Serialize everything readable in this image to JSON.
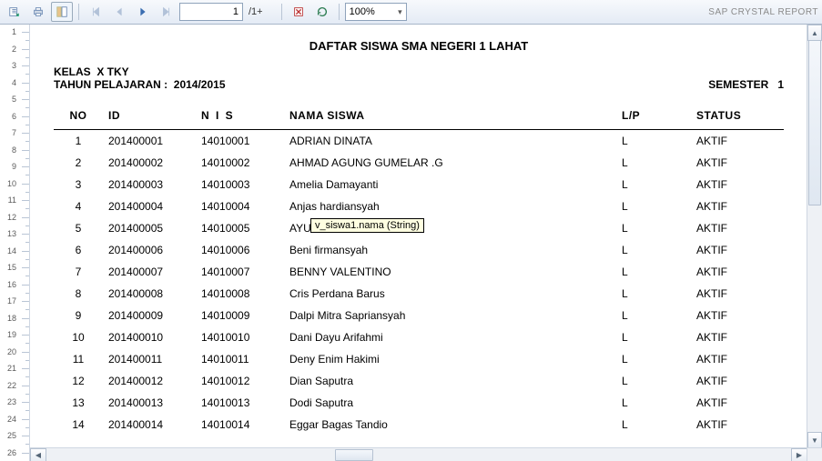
{
  "toolbar": {
    "page_current": "1",
    "page_total": "/1+",
    "zoom": "100%",
    "brand": "SAP CRYSTAL REPORT"
  },
  "report": {
    "title": "DAFTAR SISWA SMA  NEGERI 1 LAHAT",
    "kelas_label": "KELAS",
    "kelas_value": "X TKY",
    "tahun_label": "TAHUN PELAJARAN :",
    "tahun_value": "2014/2015",
    "semester_label": "SEMESTER",
    "semester_value": "1",
    "tooltip": "v_siswa1.nama (String)",
    "columns": {
      "no": "NO",
      "id": "ID",
      "nis": "N I S",
      "nama": "NAMA SISWA",
      "lp": "L/P",
      "status": "STATUS"
    },
    "rows": [
      {
        "no": "1",
        "id": "201400001",
        "nis": "14010001",
        "nama": "ADRIAN DINATA",
        "lp": "L",
        "status": "AKTIF"
      },
      {
        "no": "2",
        "id": "201400002",
        "nis": "14010002",
        "nama": "AHMAD AGUNG GUMELAR .G",
        "lp": "L",
        "status": "AKTIF"
      },
      {
        "no": "3",
        "id": "201400003",
        "nis": "14010003",
        "nama": "Amelia Damayanti",
        "lp": "L",
        "status": "AKTIF"
      },
      {
        "no": "4",
        "id": "201400004",
        "nis": "14010004",
        "nama": "Anjas hardiansyah",
        "lp": "L",
        "status": "AKTIF"
      },
      {
        "no": "5",
        "id": "201400005",
        "nis": "14010005",
        "nama": "AYU WANDIRA",
        "lp": "L",
        "status": "AKTIF"
      },
      {
        "no": "6",
        "id": "201400006",
        "nis": "14010006",
        "nama": "Beni firmansyah",
        "lp": "L",
        "status": "AKTIF"
      },
      {
        "no": "7",
        "id": "201400007",
        "nis": "14010007",
        "nama": "BENNY VALENTINO",
        "lp": "L",
        "status": "AKTIF"
      },
      {
        "no": "8",
        "id": "201400008",
        "nis": "14010008",
        "nama": "Cris Perdana Barus",
        "lp": "L",
        "status": "AKTIF"
      },
      {
        "no": "9",
        "id": "201400009",
        "nis": "14010009",
        "nama": "Dalpi Mitra Sapriansyah",
        "lp": "L",
        "status": "AKTIF"
      },
      {
        "no": "10",
        "id": "201400010",
        "nis": "14010010",
        "nama": "Dani Dayu Arifahmi",
        "lp": "L",
        "status": "AKTIF"
      },
      {
        "no": "11",
        "id": "201400011",
        "nis": "14010011",
        "nama": "Deny Enim Hakimi",
        "lp": "L",
        "status": "AKTIF"
      },
      {
        "no": "12",
        "id": "201400012",
        "nis": "14010012",
        "nama": "Dian Saputra",
        "lp": "L",
        "status": "AKTIF"
      },
      {
        "no": "13",
        "id": "201400013",
        "nis": "14010013",
        "nama": "Dodi Saputra",
        "lp": "L",
        "status": "AKTIF"
      },
      {
        "no": "14",
        "id": "201400014",
        "nis": "14010014",
        "nama": "Eggar Bagas Tandio",
        "lp": "L",
        "status": "AKTIF"
      }
    ]
  }
}
